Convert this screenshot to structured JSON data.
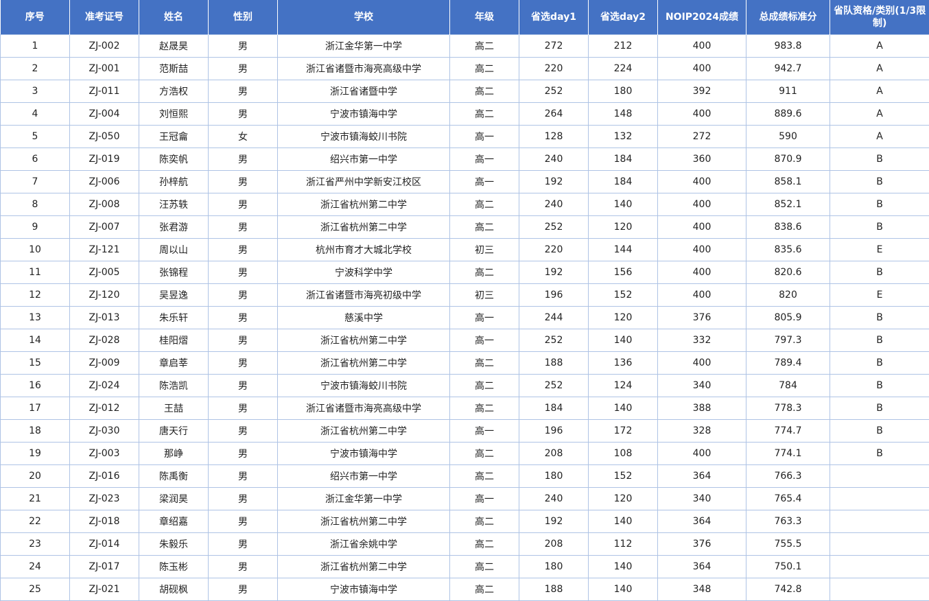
{
  "table": {
    "headers": [
      "序号",
      "准考证号",
      "姓名",
      "性别",
      "学校",
      "年级",
      "省选day1",
      "省选day2",
      "NOIP2024成绩",
      "总成绩标准分",
      "省队资格/类别(1/3限制)"
    ],
    "rows": [
      [
        "1",
        "ZJ-002",
        "赵晟昊",
        "男",
        "浙江金华第一中学",
        "高二",
        "272",
        "212",
        "400",
        "983.8",
        "A"
      ],
      [
        "2",
        "ZJ-001",
        "范斯喆",
        "男",
        "浙江省诸暨市海亮高级中学",
        "高二",
        "220",
        "224",
        "400",
        "942.7",
        "A"
      ],
      [
        "3",
        "ZJ-011",
        "方浩权",
        "男",
        "浙江省诸暨中学",
        "高二",
        "252",
        "180",
        "392",
        "911",
        "A"
      ],
      [
        "4",
        "ZJ-004",
        "刘恒熙",
        "男",
        "宁波市镇海中学",
        "高二",
        "264",
        "148",
        "400",
        "889.6",
        "A"
      ],
      [
        "5",
        "ZJ-050",
        "王冠龠",
        "女",
        "宁波市镇海蛟川书院",
        "高一",
        "128",
        "132",
        "272",
        "590",
        "A"
      ],
      [
        "6",
        "ZJ-019",
        "陈奕帆",
        "男",
        "绍兴市第一中学",
        "高一",
        "240",
        "184",
        "360",
        "870.9",
        "B"
      ],
      [
        "7",
        "ZJ-006",
        "孙梓航",
        "男",
        "浙江省严州中学新安江校区",
        "高一",
        "192",
        "184",
        "400",
        "858.1",
        "B"
      ],
      [
        "8",
        "ZJ-008",
        "汪苏轶",
        "男",
        "浙江省杭州第二中学",
        "高二",
        "240",
        "140",
        "400",
        "852.1",
        "B"
      ],
      [
        "9",
        "ZJ-007",
        "张君游",
        "男",
        "浙江省杭州第二中学",
        "高二",
        "252",
        "120",
        "400",
        "838.6",
        "B"
      ],
      [
        "10",
        "ZJ-121",
        "周以山",
        "男",
        "杭州市育才大城北学校",
        "初三",
        "220",
        "144",
        "400",
        "835.6",
        "E"
      ],
      [
        "11",
        "ZJ-005",
        "张锦程",
        "男",
        "宁波科学中学",
        "高二",
        "192",
        "156",
        "400",
        "820.6",
        "B"
      ],
      [
        "12",
        "ZJ-120",
        "吴昱逸",
        "男",
        "浙江省诸暨市海亮初级中学",
        "初三",
        "196",
        "152",
        "400",
        "820",
        "E"
      ],
      [
        "13",
        "ZJ-013",
        "朱乐轩",
        "男",
        "慈溪中学",
        "高一",
        "244",
        "120",
        "376",
        "805.9",
        "B"
      ],
      [
        "14",
        "ZJ-028",
        "桂阳熠",
        "男",
        "浙江省杭州第二中学",
        "高一",
        "252",
        "140",
        "332",
        "797.3",
        "B"
      ],
      [
        "15",
        "ZJ-009",
        "章启莘",
        "男",
        "浙江省杭州第二中学",
        "高二",
        "188",
        "136",
        "400",
        "789.4",
        "B"
      ],
      [
        "16",
        "ZJ-024",
        "陈浩凯",
        "男",
        "宁波市镇海蛟川书院",
        "高二",
        "252",
        "124",
        "340",
        "784",
        "B"
      ],
      [
        "17",
        "ZJ-012",
        "王喆",
        "男",
        "浙江省诸暨市海亮高级中学",
        "高二",
        "184",
        "140",
        "388",
        "778.3",
        "B"
      ],
      [
        "18",
        "ZJ-030",
        "唐天行",
        "男",
        "浙江省杭州第二中学",
        "高一",
        "196",
        "172",
        "328",
        "774.7",
        "B"
      ],
      [
        "19",
        "ZJ-003",
        "那峥",
        "男",
        "宁波市镇海中学",
        "高二",
        "208",
        "108",
        "400",
        "774.1",
        "B"
      ],
      [
        "20",
        "ZJ-016",
        "陈禹衡",
        "男",
        "绍兴市第一中学",
        "高二",
        "180",
        "152",
        "364",
        "766.3",
        ""
      ],
      [
        "21",
        "ZJ-023",
        "梁润昊",
        "男",
        "浙江金华第一中学",
        "高一",
        "240",
        "120",
        "340",
        "765.4",
        ""
      ],
      [
        "22",
        "ZJ-018",
        "章绍嘉",
        "男",
        "浙江省杭州第二中学",
        "高二",
        "192",
        "140",
        "364",
        "763.3",
        ""
      ],
      [
        "23",
        "ZJ-014",
        "朱毅乐",
        "男",
        "浙江省余姚中学",
        "高二",
        "208",
        "112",
        "376",
        "755.5",
        ""
      ],
      [
        "24",
        "ZJ-017",
        "陈玉彬",
        "男",
        "浙江省杭州第二中学",
        "高二",
        "180",
        "140",
        "364",
        "750.1",
        ""
      ],
      [
        "25",
        "ZJ-021",
        "胡砚枫",
        "男",
        "宁波市镇海中学",
        "高二",
        "188",
        "140",
        "348",
        "742.8",
        ""
      ]
    ]
  }
}
